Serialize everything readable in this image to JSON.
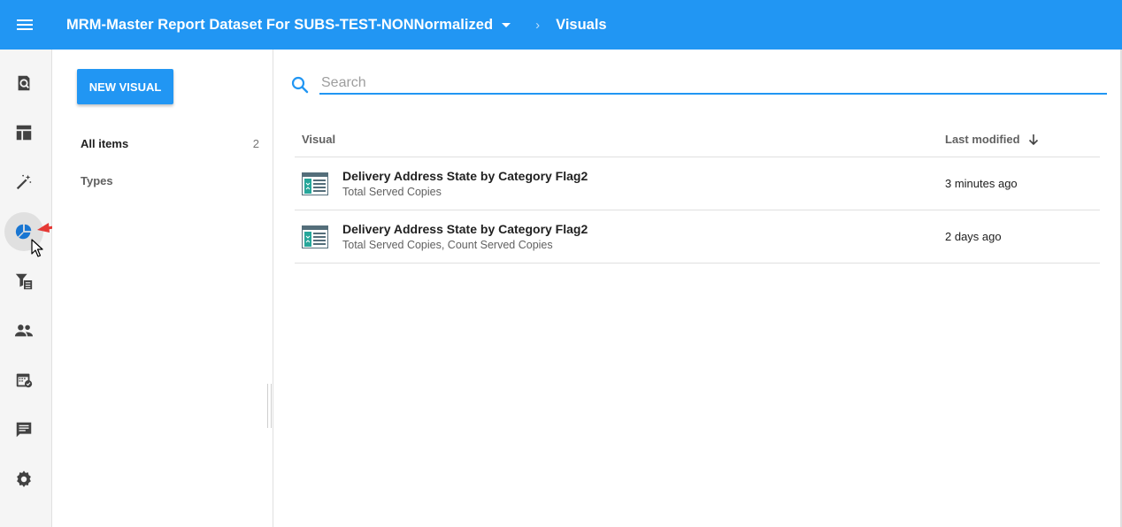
{
  "header": {
    "menu_icon": "hamburger-menu-icon",
    "dataset_title": "MRM-Master Report Dataset For SUBS-TEST-NONNormalized",
    "separator": "›",
    "page_title": "Visuals"
  },
  "rail": {
    "items": [
      {
        "name": "explore",
        "icon": "search-document-icon"
      },
      {
        "name": "dashboards",
        "icon": "dashboard-layout-icon"
      },
      {
        "name": "wizard",
        "icon": "magic-wand-icon"
      },
      {
        "name": "visuals",
        "icon": "pie-chart-icon",
        "active": true
      },
      {
        "name": "filters",
        "icon": "filter-list-icon"
      },
      {
        "name": "users",
        "icon": "people-icon"
      },
      {
        "name": "schedules",
        "icon": "calendar-check-icon"
      },
      {
        "name": "comments",
        "icon": "comment-icon"
      },
      {
        "name": "settings",
        "icon": "gear-icon"
      }
    ]
  },
  "panel": {
    "new_visual_label": "NEW VISUAL",
    "all_items_label": "All items",
    "all_items_count": "2",
    "types_label": "Types"
  },
  "search": {
    "placeholder": "Search",
    "value": ""
  },
  "table": {
    "col_visual": "Visual",
    "col_last_modified": "Last modified",
    "sort_icon": "arrow-down-icon",
    "rows": [
      {
        "title": "Delivery Address State by Category Flag2",
        "subtitle": "Total Served Copies",
        "modified": "3 minutes ago",
        "icon": "table-visual-icon"
      },
      {
        "title": "Delivery Address State by Category Flag2",
        "subtitle": "Total Served Copies, Count Served Copies",
        "modified": "2 days ago",
        "icon": "table-visual-icon"
      }
    ]
  },
  "colors": {
    "accent": "#2196f3",
    "annotation_arrow": "#e53935"
  }
}
